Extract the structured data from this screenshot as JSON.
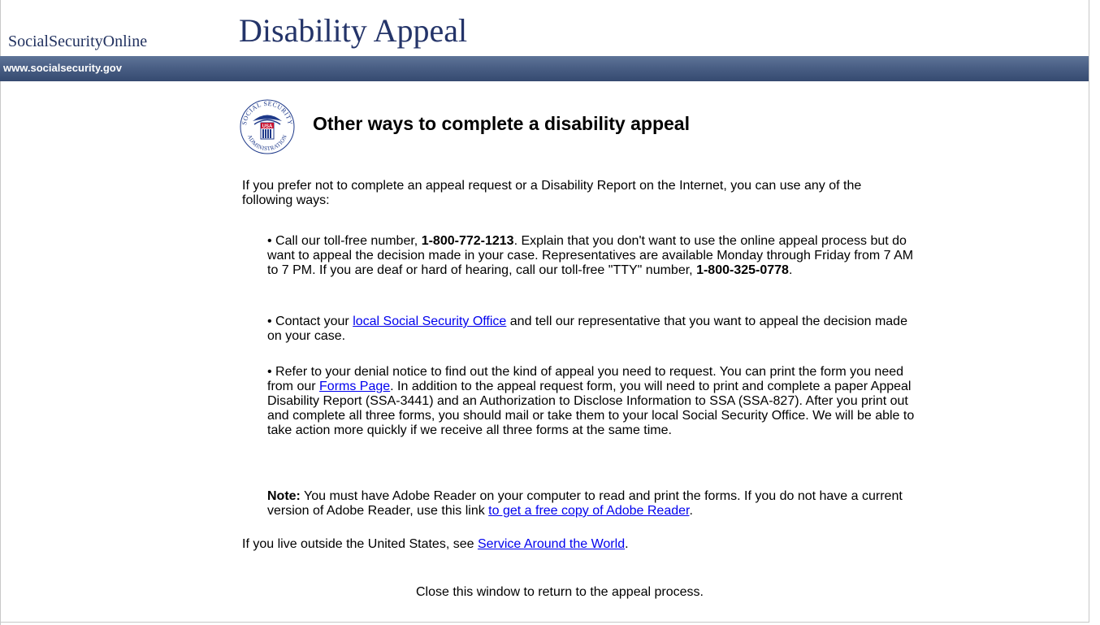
{
  "header": {
    "brand": "SocialSecurityOnline",
    "title": "Disability Appeal",
    "site_url": "www.socialsecurity.gov"
  },
  "seal": {
    "top_text": "SOCIAL SECURITY",
    "center_text": "USA",
    "bottom_text": "ADMINISTRATION",
    "colors": {
      "primary": "#1f3a8a",
      "accent": "#c8102e"
    }
  },
  "content": {
    "heading": "Other ways to complete a disability appeal",
    "intro": "If you prefer not to complete an appeal request or a Disability Report on the Internet, you can use any of the following ways:",
    "bullet1": {
      "prefix": "• Call our toll-free number, ",
      "phone": "1-800-772-1213",
      "middle": ". Explain that you don't want to use the online appeal process but do want to appeal the decision made in your case. Representatives are available Monday through Friday from 7 AM to 7 PM. If you are deaf or hard of hearing, call our toll-free \"TTY\" number, ",
      "tty": "1-800-325-0778",
      "suffix": "."
    },
    "bullet2": {
      "prefix": "• Contact your ",
      "link": "local Social Security Office",
      "suffix": " and tell our representative that you want to appeal the decision made on your case."
    },
    "bullet3": {
      "prefix": "• Refer to your denial notice to find out the kind of appeal you need to request. You can print the form you need from our ",
      "link": "Forms Page",
      "suffix": ". In addition to the appeal request form, you will need to print and complete a paper Appeal Disability Report (SSA-3441) and an Authorization to Disclose Information to SSA (SSA-827). After you print out and complete all three forms, you should mail or take them to your local Social Security Office. We will be able to take action more quickly if we receive all three forms at the same time."
    },
    "note": {
      "label": "Note:",
      "text": " You must have Adobe Reader on your computer to read and print the forms. If you do not have a current version of Adobe Reader, use this link ",
      "link": "to get a free copy of Adobe Reader",
      "suffix": "."
    },
    "outside": {
      "prefix": "If you live outside the United States, see ",
      "link": "Service Around the World",
      "suffix": "."
    },
    "close_message": "Close this window to return to the appeal process."
  }
}
